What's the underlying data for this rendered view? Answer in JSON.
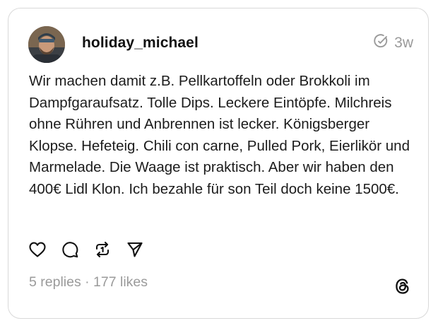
{
  "post": {
    "username": "holiday_michael",
    "time": "3w",
    "text": "Wir machen damit z.B. Pellkartoffeln oder Brokkoli im Dampfgaraufsatz. Tolle Dips. Leckere Eintöpfe. Milchreis ohne Rühren und Anbrennen ist lecker. Königsberger Klopse. Hefeteig. Chili con carne, Pulled Pork, Eierlikör und Marmelade. Die Waage ist praktisch. Aber wir haben den 400€ Lidl Klon. Ich bezahle für son Teil doch keine 1500€.",
    "stats": "5 replies · 177 likes"
  },
  "icons": {
    "meta": "edited-clock-icon",
    "like": "heart-icon",
    "reply": "comment-bubble-icon",
    "repost": "repost-icon",
    "share": "send-icon",
    "brand": "threads-logo-icon"
  },
  "colors": {
    "text": "#1c1c1c",
    "muted": "#9a9a9a",
    "border": "#d9d9d9"
  }
}
